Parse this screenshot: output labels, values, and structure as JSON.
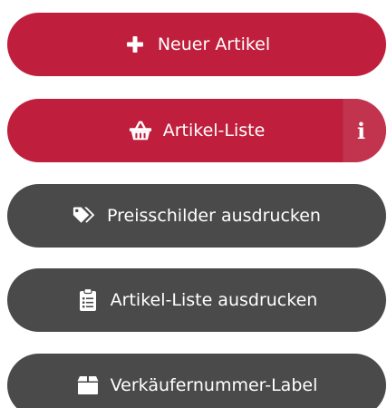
{
  "buttons": [
    {
      "label": "Neuer Artikel",
      "icon": "plus-icon",
      "color": "#bf1f3c"
    },
    {
      "label": "Artikel-Liste",
      "icon": "basket-icon",
      "color": "#bf1f3c",
      "info_icon": "info-icon",
      "info_glyph": "i"
    },
    {
      "label": "Preisschilder ausdrucken",
      "icon": "tags-icon",
      "color": "#4a4a4a"
    },
    {
      "label": "Artikel-Liste ausdrucken",
      "icon": "clipboard-list-icon",
      "color": "#4a4a4a"
    },
    {
      "label": "Verkäufernummer-Label",
      "icon": "box-icon",
      "color": "#4a4a4a"
    }
  ]
}
